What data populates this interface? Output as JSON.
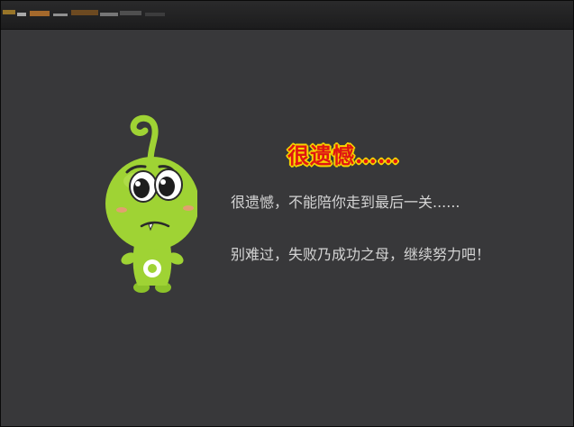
{
  "dialog": {
    "heading": "很遗憾……",
    "message_line1": "很遗憾，不能陪你走到最后一关......",
    "message_line2": "别难过，失败乃成功之母，继续努力吧！"
  },
  "mascot": {
    "icon": "sad-green-alien-icon",
    "body_color": "#9fd334",
    "background_color": "#363638"
  },
  "colors": {
    "heading_fill": "#e01612",
    "heading_outline": "#f5d400",
    "message_text": "#d4d4d4"
  }
}
